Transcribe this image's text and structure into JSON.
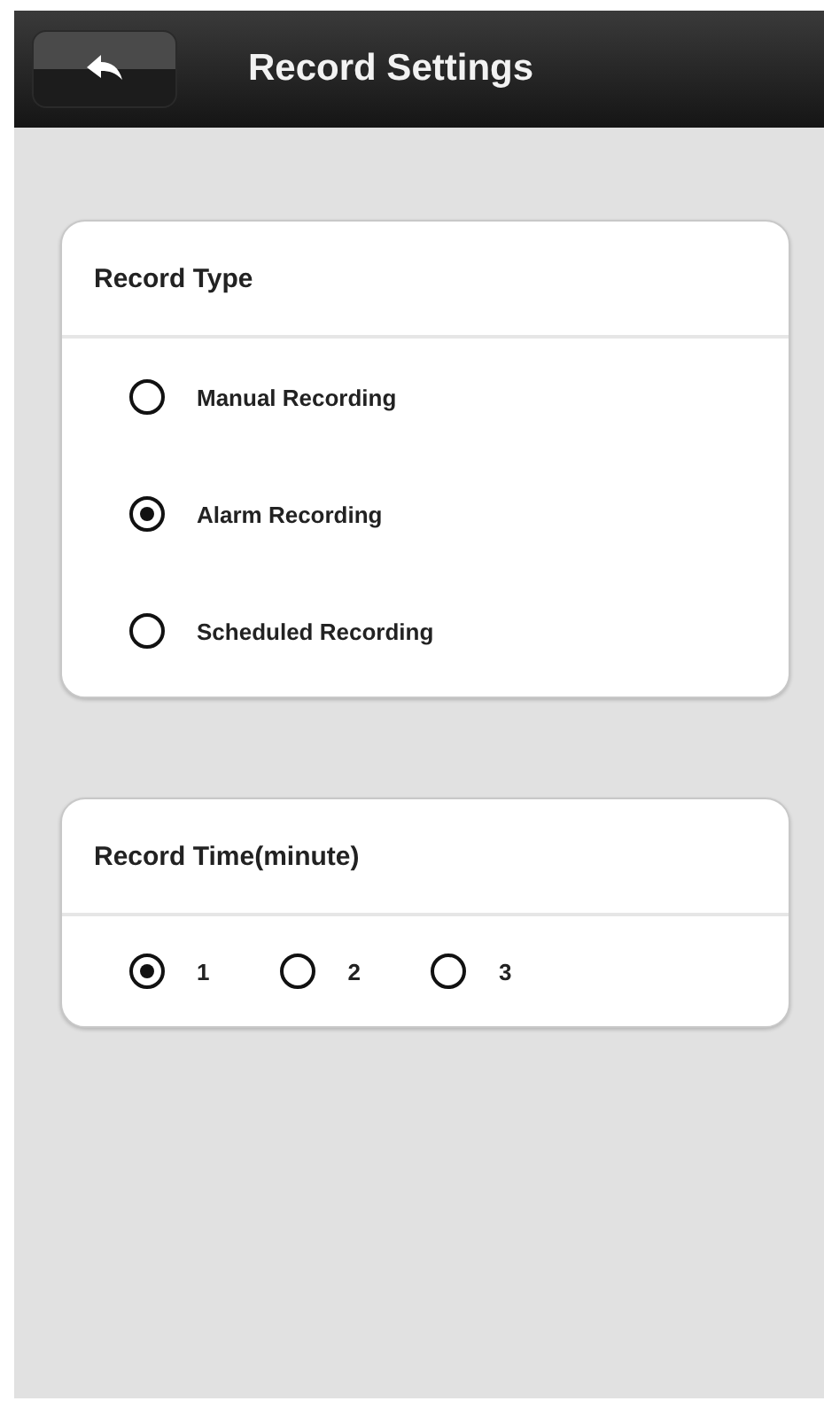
{
  "header": {
    "title": "Record Settings"
  },
  "record_type": {
    "title": "Record Type",
    "options": [
      {
        "label": "Manual Recording",
        "selected": false
      },
      {
        "label": "Alarm Recording",
        "selected": true
      },
      {
        "label": "Scheduled Recording",
        "selected": false
      }
    ]
  },
  "record_time": {
    "title": "Record Time(minute)",
    "options": [
      {
        "label": "1",
        "selected": true
      },
      {
        "label": "2",
        "selected": false
      },
      {
        "label": "3",
        "selected": false
      }
    ]
  }
}
